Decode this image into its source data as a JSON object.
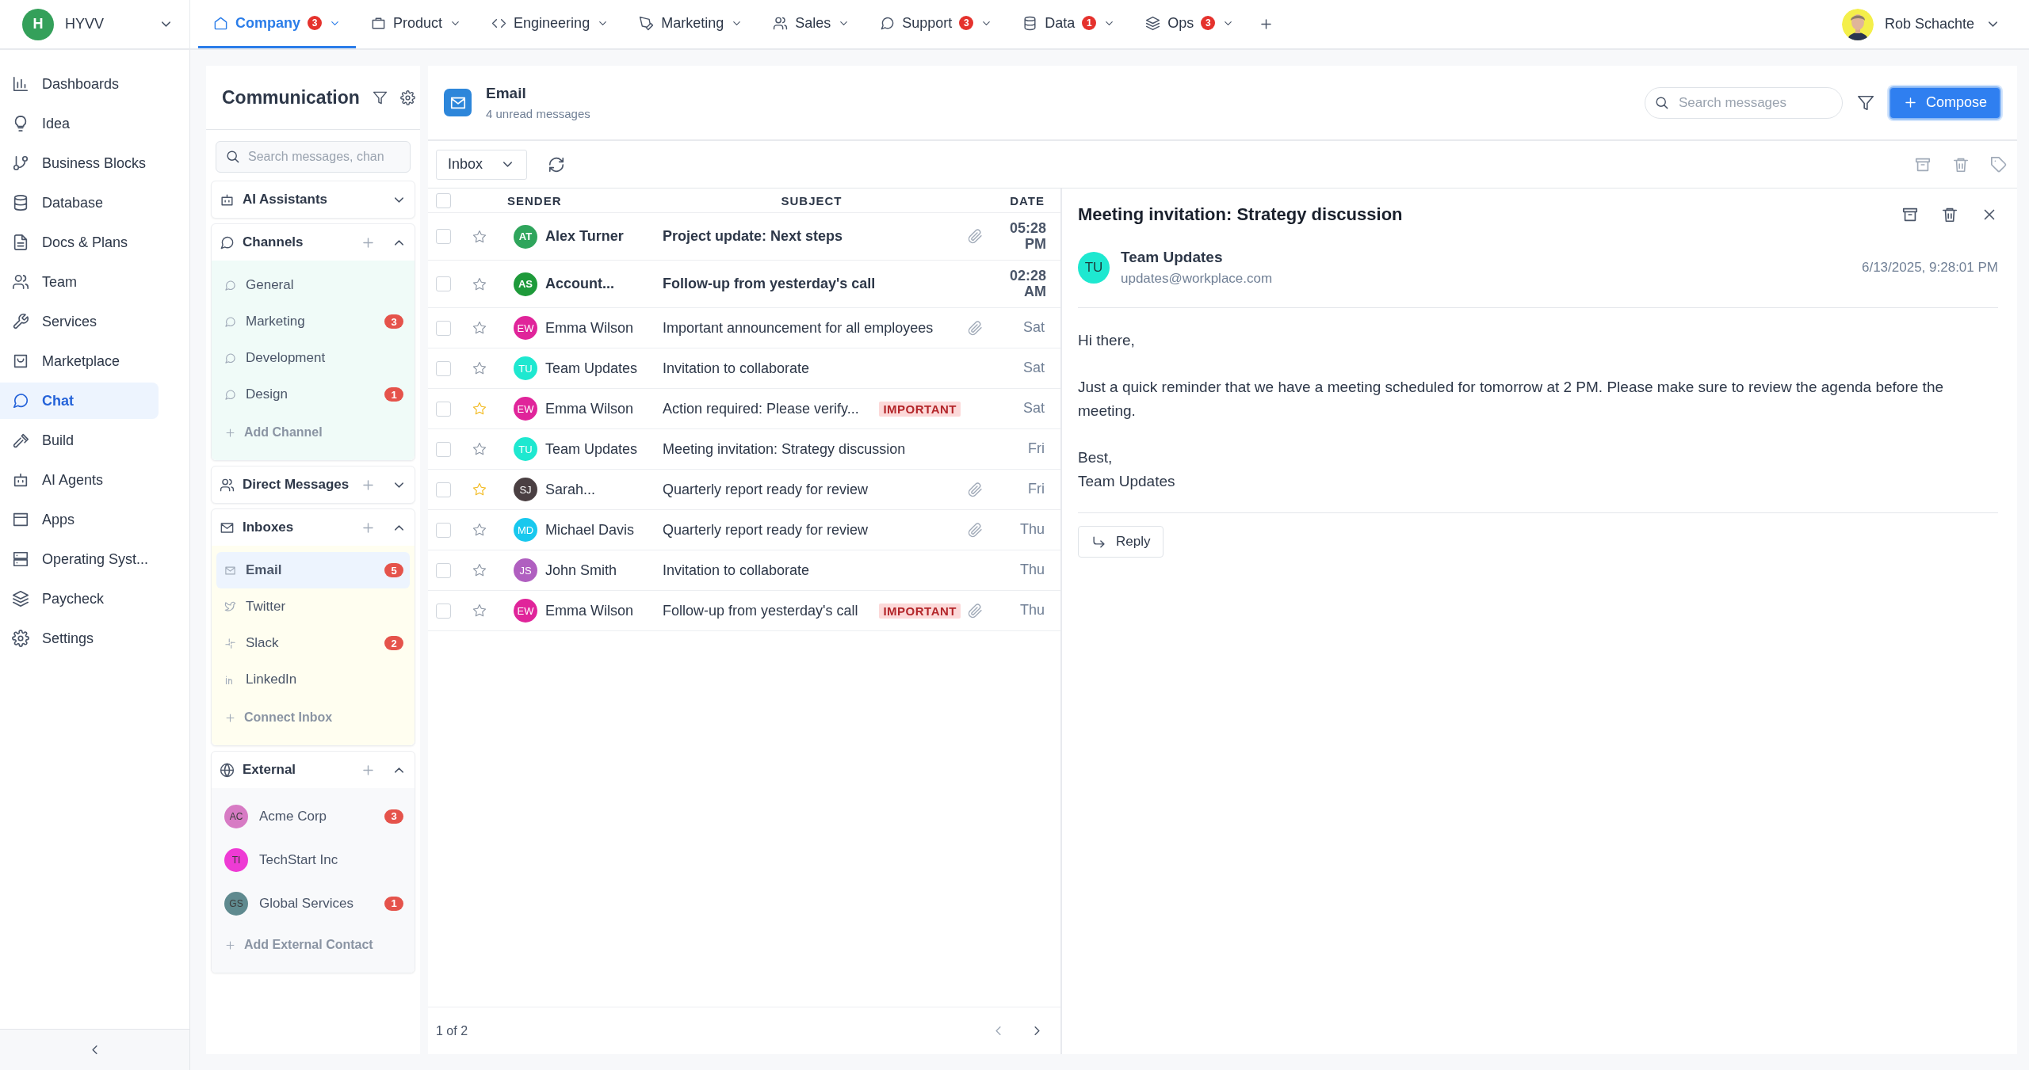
{
  "workspace": {
    "initial": "H",
    "name": "HYVV"
  },
  "top_tabs": [
    {
      "label": "Company",
      "badge": "3",
      "selected": true
    },
    {
      "label": "Product",
      "selected": false
    },
    {
      "label": "Engineering",
      "selected": false
    },
    {
      "label": "Marketing",
      "selected": false
    },
    {
      "label": "Sales",
      "selected": false
    },
    {
      "label": "Support",
      "badge": "3",
      "selected": false
    },
    {
      "label": "Data",
      "badge": "1",
      "selected": false
    },
    {
      "label": "Ops",
      "badge": "3",
      "selected": false
    }
  ],
  "user": {
    "name": "Rob Schachte"
  },
  "sidebar": {
    "items": [
      {
        "label": "Dashboards",
        "selected": false
      },
      {
        "label": "Idea",
        "selected": false
      },
      {
        "label": "Business Blocks",
        "selected": false
      },
      {
        "label": "Database",
        "selected": false
      },
      {
        "label": "Docs & Plans",
        "selected": false
      },
      {
        "label": "Team",
        "selected": false
      },
      {
        "label": "Services",
        "selected": false
      },
      {
        "label": "Marketplace",
        "selected": false
      },
      {
        "label": "Chat",
        "selected": true
      },
      {
        "label": "Build",
        "selected": false
      },
      {
        "label": "AI Agents",
        "selected": false
      },
      {
        "label": "Apps",
        "selected": false
      },
      {
        "label": "Operating Syst...",
        "selected": false
      },
      {
        "label": "Paycheck",
        "selected": false
      },
      {
        "label": "Settings",
        "selected": false
      }
    ]
  },
  "communication": {
    "title": "Communication",
    "search": {
      "placeholder": "Search messages, chan"
    },
    "sections": [
      {
        "title": "AI Assistants",
        "addable": false,
        "expanded": false
      },
      {
        "title": "Channels",
        "addable": true,
        "expanded": true,
        "color": "#f0fbf8",
        "add_label": "Add Channel",
        "items": [
          {
            "kind": "channel",
            "label": "General",
            "selected": false
          },
          {
            "kind": "channel",
            "label": "Marketing",
            "badge": "3",
            "selected": false
          },
          {
            "kind": "channel",
            "label": "Development",
            "selected": false
          },
          {
            "kind": "channel",
            "label": "Design",
            "badge": "1",
            "selected": false
          }
        ]
      },
      {
        "title": "Direct Messages",
        "addable": true,
        "expanded": false
      },
      {
        "title": "Inboxes",
        "addable": true,
        "expanded": true,
        "color": "#fffef0",
        "add_label": "Connect Inbox",
        "items": [
          {
            "kind": "inbox",
            "label": "Email",
            "badge": "5",
            "selected": true
          },
          {
            "kind": "inbox",
            "label": "Twitter",
            "selected": false
          },
          {
            "kind": "inbox",
            "label": "Slack",
            "badge": "2",
            "selected": false
          },
          {
            "kind": "inbox",
            "label": "LinkedIn",
            "selected": false
          }
        ]
      },
      {
        "title": "External",
        "addable": true,
        "expanded": true,
        "color": "#f8f9fb",
        "add_label": "Add External Contact",
        "items": [
          {
            "kind": "contact",
            "initials": "AC",
            "color": "#d77bc4",
            "label": "Acme Corp",
            "badge": "3",
            "selected": false
          },
          {
            "kind": "contact",
            "initials": "TI",
            "color": "#ee3bd4",
            "label": "TechStart Inc",
            "selected": false
          },
          {
            "kind": "contact",
            "initials": "GS",
            "color": "#5f8a8f",
            "label": "Global Services",
            "badge": "1",
            "selected": false
          }
        ]
      }
    ]
  },
  "mailbox": {
    "title": "Email",
    "subtitle": "4 unread messages",
    "search": {
      "placeholder": "Search messages"
    },
    "compose": "Compose",
    "folder": "Inbox",
    "columns": [
      "SENDER",
      "SUBJECT",
      "DATE"
    ],
    "all_checked": false,
    "rows": [
      {
        "initials": "AT",
        "color": "#2fa55c",
        "sender": "Alex Turner",
        "subject": "Project update: Next steps",
        "date": "05:28 PM",
        "unread": true,
        "starred": false,
        "attachment": true,
        "checked": false
      },
      {
        "initials": "AS",
        "color": "#1e9a3a",
        "sender": "Account...",
        "subject": "Follow-up from yesterday's call",
        "date": "02:28 AM",
        "unread": true,
        "starred": false,
        "attachment": false,
        "checked": false
      },
      {
        "initials": "EW",
        "color": "#e0249a",
        "sender": "Emma Wilson",
        "subject": "Important announcement for all employees",
        "date": "Sat",
        "unread": false,
        "starred": false,
        "attachment": true,
        "checked": false
      },
      {
        "initials": "TU",
        "color": "#1ee8d0",
        "sender": "Team Updates",
        "subject": "Invitation to collaborate",
        "date": "Sat",
        "unread": false,
        "starred": false,
        "attachment": false,
        "checked": false
      },
      {
        "initials": "EW",
        "color": "#e0249a",
        "sender": "Emma Wilson",
        "subject": "Action required: Please verify...",
        "label": "IMPORTANT",
        "date": "Sat",
        "unread": false,
        "starred": true,
        "attachment": false,
        "checked": false
      },
      {
        "initials": "TU",
        "color": "#1ee8d0",
        "sender": "Team Updates",
        "subject": "Meeting invitation: Strategy discussion",
        "date": "Fri",
        "unread": false,
        "starred": false,
        "attachment": false,
        "checked": false
      },
      {
        "initials": "SJ",
        "color": "#4a3f42",
        "sender": "Sarah...",
        "subject": "Quarterly report ready for review",
        "date": "Fri",
        "unread": false,
        "starred": true,
        "attachment": true,
        "checked": false
      },
      {
        "initials": "MD",
        "color": "#18c8ee",
        "sender": "Michael Davis",
        "subject": "Quarterly report ready for review",
        "date": "Thu",
        "unread": false,
        "starred": false,
        "attachment": true,
        "checked": false
      },
      {
        "initials": "JS",
        "color": "#b05fc0",
        "sender": "John Smith",
        "subject": "Invitation to collaborate",
        "date": "Thu",
        "unread": false,
        "starred": false,
        "attachment": false,
        "checked": false
      },
      {
        "initials": "EW",
        "color": "#e0249a",
        "sender": "Emma Wilson",
        "subject": "Follow-up from yesterday's call",
        "label": "IMPORTANT",
        "date": "Thu",
        "unread": false,
        "starred": false,
        "attachment": true,
        "checked": false
      }
    ],
    "pagination": "1 of 2"
  },
  "message": {
    "subject": "Meeting invitation: Strategy discussion",
    "initials": "TU",
    "color": "#1ee8d0",
    "sender": "Team Updates",
    "email": "updates@workplace.com",
    "date": "6/13/2025, 9:28:01 PM",
    "body": [
      [
        "Hi there,"
      ],
      [
        "Just a quick reminder that we have a meeting scheduled for tomorrow at 2 PM. Please make sure to review the agenda before the meeting."
      ],
      [
        "Best,",
        "Team Updates"
      ]
    ],
    "reply": "Reply"
  }
}
